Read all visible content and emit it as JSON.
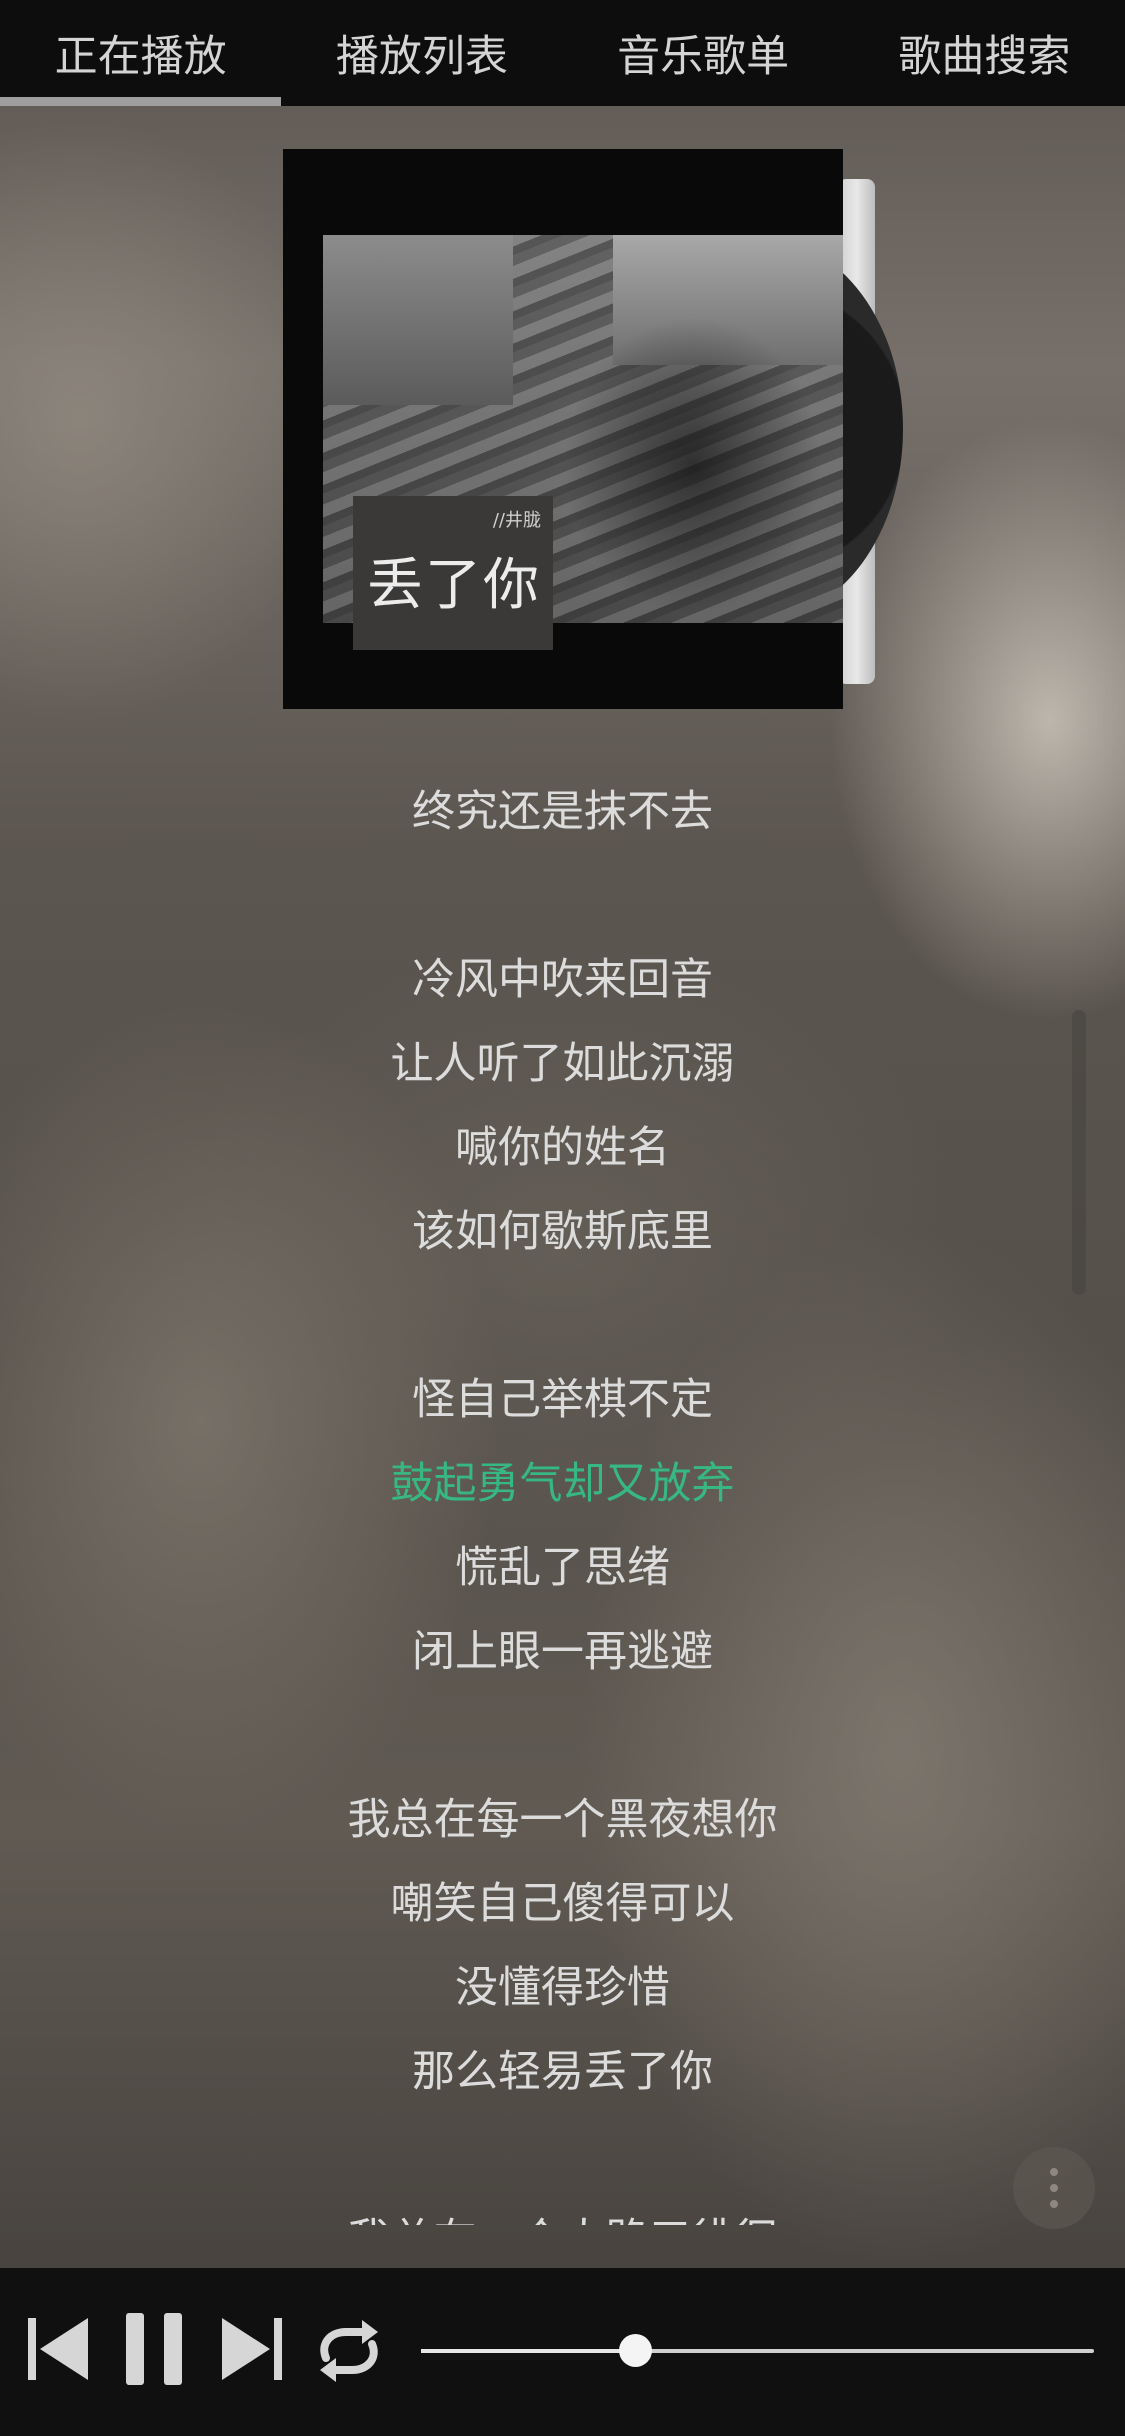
{
  "tabs": [
    {
      "label": "正在播放",
      "active": true
    },
    {
      "label": "播放列表",
      "active": false
    },
    {
      "label": "音乐歌单",
      "active": false
    },
    {
      "label": "歌曲搜索",
      "active": false
    }
  ],
  "album": {
    "artist": "//井胧",
    "title": "丢了你"
  },
  "lyrics": {
    "current_index": 8,
    "lines": [
      "终究还是抹不去",
      "",
      "冷风中吹来回音",
      "让人听了如此沉溺",
      "喊你的姓名",
      "该如何歇斯底里",
      "",
      "怪自己举棋不定",
      "鼓起勇气却又放弃",
      "慌乱了思绪",
      "闭上眼一再逃避",
      "",
      "我总在每一个黑夜想你",
      "嘲笑自己傻得可以",
      "没懂得珍惜",
      "那么轻易丢了你",
      "",
      "我总在一个人路口徘徊"
    ]
  },
  "player": {
    "progress": 0.318,
    "state": "playing",
    "repeat_mode": "repeat"
  },
  "icons": {
    "prev": "skip-previous-icon",
    "pause": "pause-icon",
    "next": "skip-next-icon",
    "repeat": "repeat-icon",
    "more": "more-vertical-icon"
  },
  "colors": {
    "current_lyric": "#37b882",
    "lyric": "#dcdcdc",
    "tab_bar": "#0d0d0d",
    "control_bar": "#101010"
  }
}
